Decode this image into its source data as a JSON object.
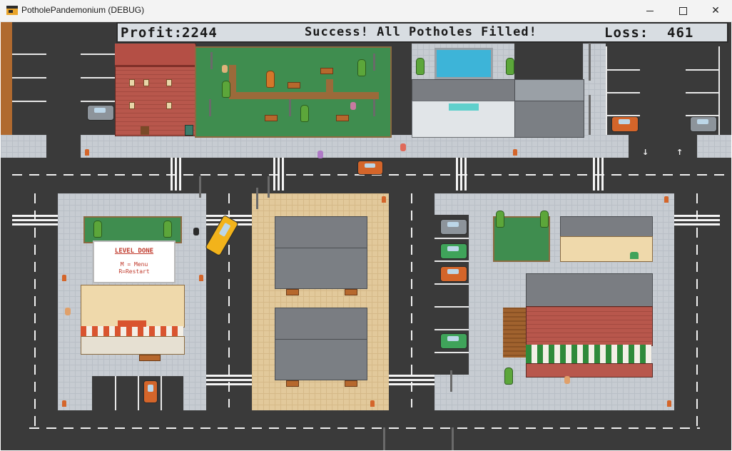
{
  "window": {
    "title": "PotholePandemonium (DEBUG)",
    "icon": "app-icon",
    "controls": {
      "minimize": "minimize-icon",
      "maximize": "maximize-icon",
      "close": "close-icon"
    },
    "close_glyph": "✕"
  },
  "hud": {
    "profit_label": "Profit:",
    "profit_value": "2244",
    "status_message": "Success! All Potholes Filled!",
    "loss_label": "Loss:",
    "loss_value": "461"
  },
  "billboard": {
    "title": "LEVEL DONE",
    "line1": "M = Menu",
    "line2": "R=Restart"
  },
  "parking_arrows": {
    "down": "↓",
    "up": "↑"
  },
  "colors": {
    "road": "#3a3a3a",
    "grass": "#3f8d4f",
    "taxi": "#f2b31b",
    "hud_bg": "#d8dde2",
    "billboard_text": "#c0392b"
  }
}
